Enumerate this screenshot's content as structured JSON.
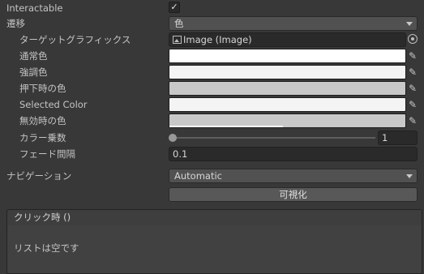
{
  "interactable": {
    "label": "Interactable",
    "checked_glyph": "✓"
  },
  "transition": {
    "label": "遷移",
    "value": "色"
  },
  "target_graphic": {
    "label": "ターゲットグラフィックス",
    "value": "Image (Image)"
  },
  "normal_color": {
    "label": "通常色",
    "color": "#ffffff"
  },
  "highlighted_color": {
    "label": "強調色",
    "color": "#f4f4f4"
  },
  "pressed_color": {
    "label": "押下時の色",
    "color": "#c8c8c8"
  },
  "selected_color": {
    "label": "Selected Color",
    "color": "#f4f4f4"
  },
  "disabled_color": {
    "label": "無効時の色",
    "color": "#c8c8c8"
  },
  "color_multiplier": {
    "label": "カラー乗数",
    "value": "1"
  },
  "fade_duration": {
    "label": "フェード間隔",
    "value": "0.1"
  },
  "navigation": {
    "label": "ナビゲーション",
    "value": "Automatic"
  },
  "visualize_button": {
    "label": "可視化"
  },
  "on_click": {
    "header": "クリック時 ()",
    "empty_text": "リストは空です"
  },
  "icons": {
    "eyedropper": "✎"
  }
}
